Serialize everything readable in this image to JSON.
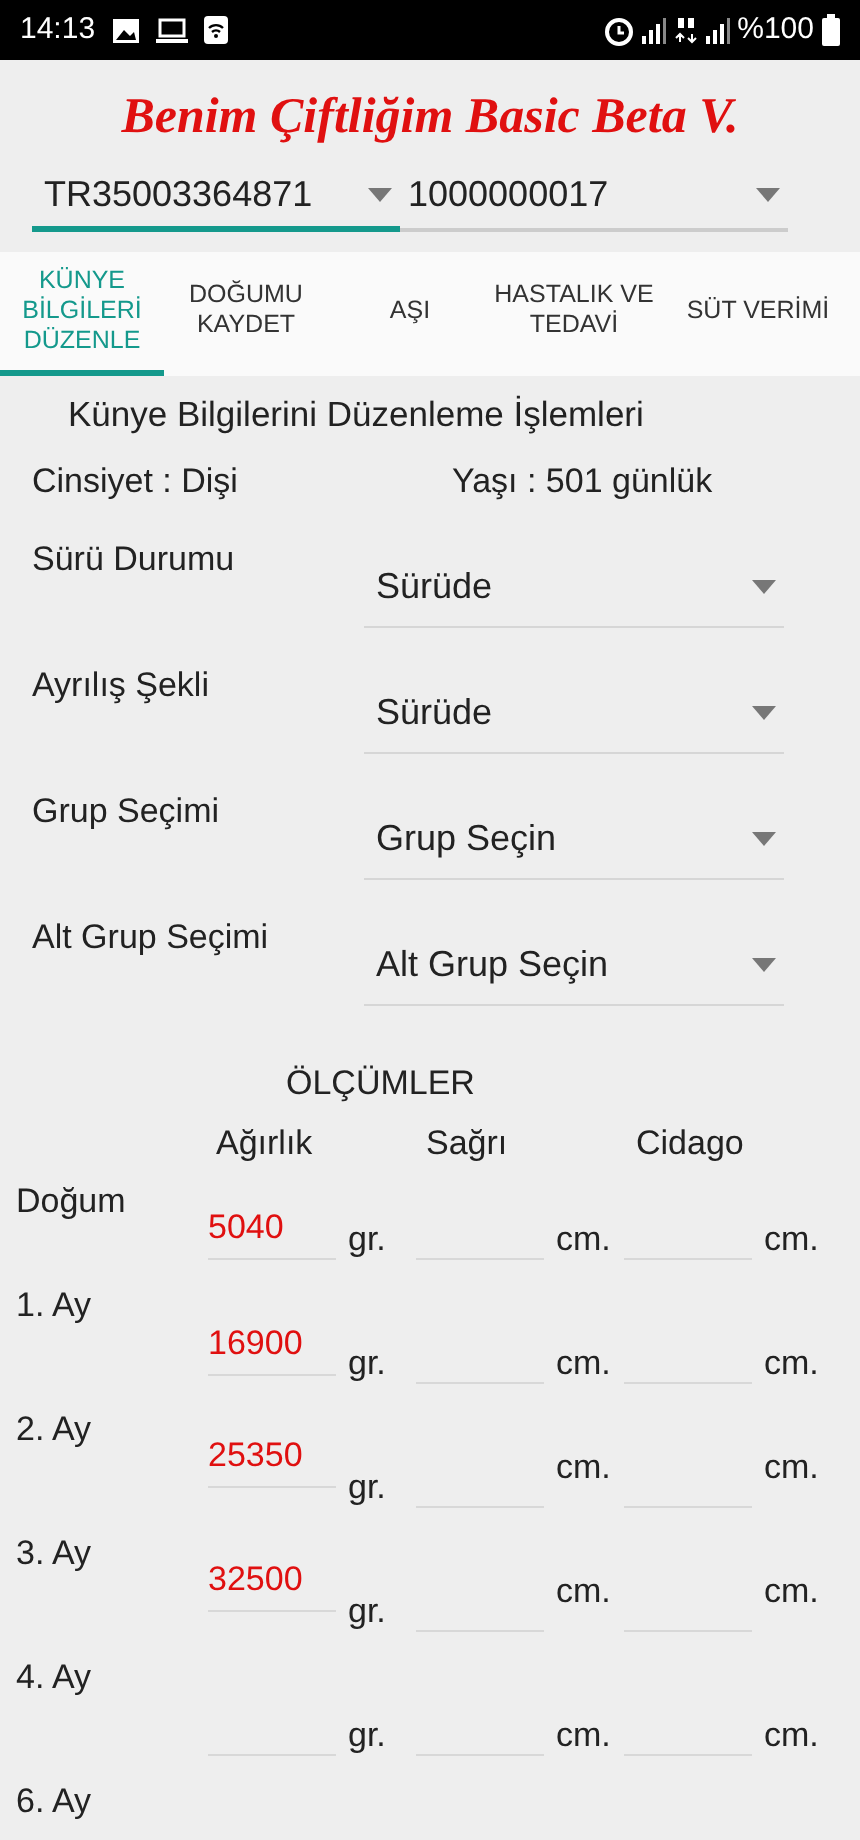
{
  "status_bar": {
    "time": "14:13",
    "battery_text": "%100"
  },
  "app_title": "Benim Çiftliğim Basic Beta V.",
  "animal_selectors": [
    {
      "value": "TR35003364871",
      "focused": true
    },
    {
      "value": "1000000017",
      "focused": false
    }
  ],
  "tabs": [
    {
      "label": "KÜNYE BİLGİLERİ DÜZENLE",
      "selected": true
    },
    {
      "label": "DOĞUMU KAYDET",
      "selected": false
    },
    {
      "label": "AŞI",
      "selected": false
    },
    {
      "label": "HASTALIK VE TEDAVİ",
      "selected": false
    },
    {
      "label": "SÜT VERİMİ",
      "selected": false
    }
  ],
  "section_title": "Künye Bilgilerini Düzenleme İşlemleri",
  "info": {
    "gender": "Cinsiyet : Dişi",
    "age": "Yaşı : 501 günlük"
  },
  "form_rows": [
    {
      "label": "Sürü Durumu",
      "value": "Sürüde"
    },
    {
      "label": "Ayrılış Şekli",
      "value": "Sürüde"
    },
    {
      "label": "Grup Seçimi",
      "value": "Grup Seçin"
    },
    {
      "label": "Alt Grup Seçimi",
      "value": "Alt Grup Seçin"
    }
  ],
  "measurements": {
    "title": "ÖLÇÜMLER",
    "columns": [
      "Ağırlık",
      "Sağrı",
      "Cidago"
    ],
    "rows": [
      {
        "label": "Doğum",
        "weight": "5040",
        "units": [
          "gr.",
          "cm.",
          "cm."
        ]
      },
      {
        "label": "1. Ay",
        "weight": "16900",
        "units": [
          "gr.",
          "cm.",
          "cm."
        ]
      },
      {
        "label": "2. Ay",
        "weight": "25350",
        "units": [
          "gr.",
          "cm.",
          "cm."
        ]
      },
      {
        "label": "3. Ay",
        "weight": "32500",
        "units": [
          "gr.",
          "cm.",
          "cm."
        ]
      },
      {
        "label": "4. Ay",
        "units": [
          "gr.",
          "cm.",
          "cm."
        ]
      },
      {
        "label": "6. Ay"
      }
    ]
  }
}
